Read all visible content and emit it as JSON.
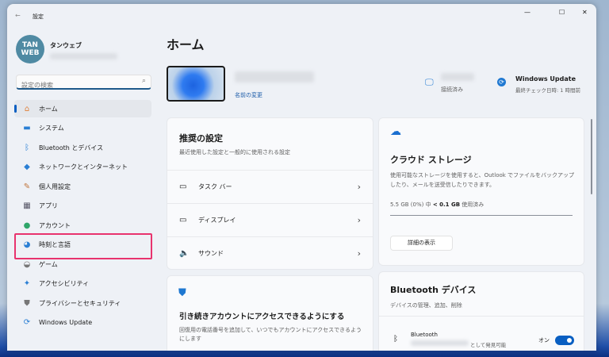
{
  "titlebar": {
    "title": "設定",
    "back": "←",
    "minimize": "—",
    "maximize": "☐",
    "close": "✕"
  },
  "profile": {
    "name": "タンウェブ",
    "avatar_text": "TAN WEB"
  },
  "search": {
    "placeholder": "設定の検索"
  },
  "nav": [
    {
      "label": "ホーム",
      "icon": "home-icon",
      "glyph": "⌂",
      "color": "#e0803a"
    },
    {
      "label": "システム",
      "icon": "system-icon",
      "glyph": "▬",
      "color": "#2a7fd4"
    },
    {
      "label": "Bluetooth とデバイス",
      "icon": "bluetooth-icon",
      "glyph": "ᛒ",
      "color": "#2a7fd4"
    },
    {
      "label": "ネットワークとインターネット",
      "icon": "network-icon",
      "glyph": "◆",
      "color": "#2a7fd4"
    },
    {
      "label": "個人用設定",
      "icon": "brush-icon",
      "glyph": "✎",
      "color": "#c0743a"
    },
    {
      "label": "アプリ",
      "icon": "apps-icon",
      "glyph": "▦",
      "color": "#556"
    },
    {
      "label": "アカウント",
      "icon": "account-icon",
      "glyph": "●",
      "color": "#2fa66a"
    },
    {
      "label": "時刻と言語",
      "icon": "clock-globe-icon",
      "glyph": "◕",
      "color": "#2a7fd4"
    },
    {
      "label": "ゲーム",
      "icon": "game-icon",
      "glyph": "◒",
      "color": "#777"
    },
    {
      "label": "アクセシビリティ",
      "icon": "accessibility-icon",
      "glyph": "✦",
      "color": "#2a7fd4"
    },
    {
      "label": "プライバシーとセキュリティ",
      "icon": "shield-icon",
      "glyph": "⛊",
      "color": "#777"
    },
    {
      "label": "Windows Update",
      "icon": "update-icon",
      "glyph": "⟳",
      "color": "#2a7fd4"
    }
  ],
  "highlight_color": "#e8336e",
  "main": {
    "title": "ホーム",
    "rename": "名前の変更",
    "status": {
      "connected": "接続済み",
      "wu_title": "Windows Update",
      "wu_sub": "最終チェック日時: 1 時間前"
    },
    "recommended": {
      "title": "推奨の設定",
      "subtitle": "最近使用した設定と一般的に使用される設定",
      "rows": [
        "タスク バー",
        "ディスプレイ",
        "サウンド"
      ]
    },
    "account": {
      "title": "引き続きアカウントにアクセスできるようにする",
      "desc": "回復用の電話番号を追加して、いつでもアカウントにアクセスできるようにします"
    },
    "cloud": {
      "title": "クラウド ストレージ",
      "desc": "使用可能なストレージを使用すると、Outlook でファイルをバックアップしたり、メールを送受信したりできます。",
      "usage_prefix": "5.5 GB (0%) 中 ",
      "usage_bold": "< 0.1 GB",
      "usage_suffix": " 使用済み",
      "usage_percent": 0,
      "button": "詳細の表示"
    },
    "bluetooth": {
      "title": "Bluetooth デバイス",
      "subtitle": "デバイスの管理、追加、削除",
      "row_title": "Bluetooth",
      "row_sub": "として発見可能",
      "toggle_label": "オン",
      "toggle_on": true
    }
  },
  "accent": "#0a5fc2"
}
